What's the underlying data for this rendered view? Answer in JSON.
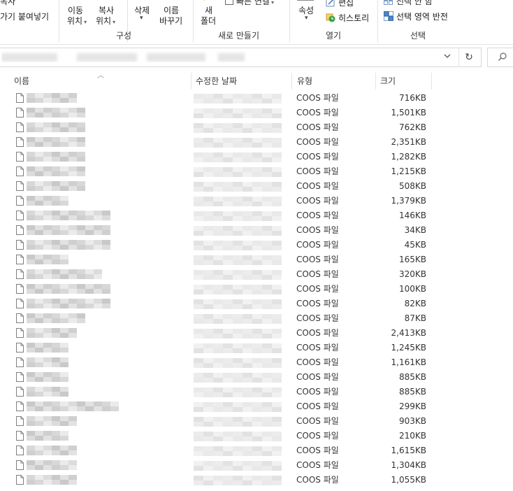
{
  "ribbon": {
    "clipboard": {
      "copy_label": "복사",
      "paste_shortcut_label": "가기 붙여넣기"
    },
    "organize": {
      "move_label": "이동",
      "move_sub": "위치",
      "copy_to_label": "복사",
      "copy_to_sub": "위치",
      "delete_label": "삭제",
      "rename_label": "이름",
      "rename_sub": "바꾸기",
      "group_label": "구성"
    },
    "new": {
      "folder_label": "새",
      "folder_sub": "폴더",
      "quick_access_label": "빠른 연결",
      "group_label": "새로 만들기"
    },
    "open": {
      "properties_label": "속성",
      "edit_label": "편집",
      "history_label": "히스토리",
      "group_label": "열기"
    },
    "select": {
      "select_none_label": "선택 안 함",
      "invert_label": "선택 영역 반전",
      "group_label": "선택"
    }
  },
  "columns": {
    "name": "이름",
    "modified": "수정한 날짜",
    "type": "유형",
    "size": "크기"
  },
  "files": [
    {
      "type": "COOS 파일",
      "size": "716KB"
    },
    {
      "type": "COOS 파일",
      "size": "1,501KB"
    },
    {
      "type": "COOS 파일",
      "size": "762KB"
    },
    {
      "type": "COOS 파일",
      "size": "2,351KB"
    },
    {
      "type": "COOS 파일",
      "size": "1,282KB"
    },
    {
      "type": "COOS 파일",
      "size": "1,215KB"
    },
    {
      "type": "COOS 파일",
      "size": "508KB"
    },
    {
      "type": "COOS 파일",
      "size": "1,379KB"
    },
    {
      "type": "COOS 파일",
      "size": "146KB"
    },
    {
      "type": "COOS 파일",
      "size": "34KB"
    },
    {
      "type": "COOS 파일",
      "size": "45KB"
    },
    {
      "type": "COOS 파일",
      "size": "165KB"
    },
    {
      "type": "COOS 파일",
      "size": "320KB"
    },
    {
      "type": "COOS 파일",
      "size": "100KB"
    },
    {
      "type": "COOS 파일",
      "size": "82KB"
    },
    {
      "type": "COOS 파일",
      "size": "87KB"
    },
    {
      "type": "COOS 파일",
      "size": "2,413KB"
    },
    {
      "type": "COOS 파일",
      "size": "1,245KB"
    },
    {
      "type": "COOS 파일",
      "size": "1,161KB"
    },
    {
      "type": "COOS 파일",
      "size": "885KB"
    },
    {
      "type": "COOS 파일",
      "size": "885KB"
    },
    {
      "type": "COOS 파일",
      "size": "299KB"
    },
    {
      "type": "COOS 파일",
      "size": "903KB"
    },
    {
      "type": "COOS 파일",
      "size": "210KB"
    },
    {
      "type": "COOS 파일",
      "size": "1,615KB"
    },
    {
      "type": "COOS 파일",
      "size": "1,304KB"
    },
    {
      "type": "COOS 파일",
      "size": "1,055KB"
    }
  ]
}
